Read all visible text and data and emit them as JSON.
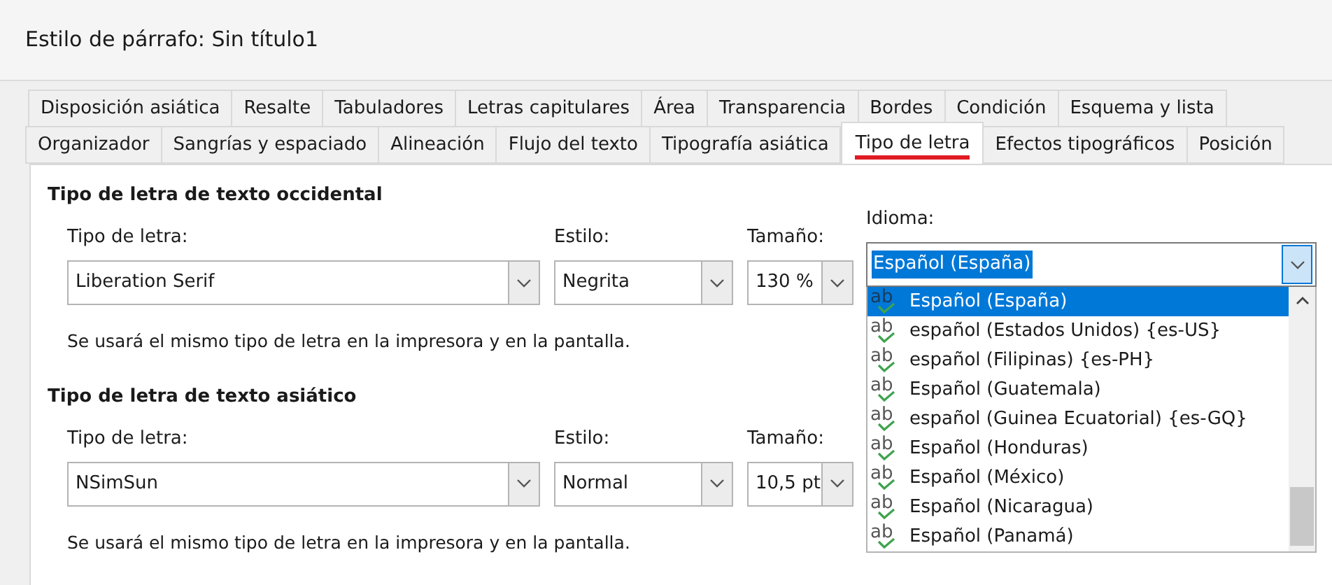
{
  "window": {
    "title": "Estilo de párrafo: Sin título1"
  },
  "tab_rows": [
    [
      {
        "label": "Disposición asiática",
        "selected": false
      },
      {
        "label": "Resalte",
        "selected": false
      },
      {
        "label": "Tabuladores",
        "selected": false
      },
      {
        "label": "Letras capitulares",
        "selected": false
      },
      {
        "label": "Área",
        "selected": false
      },
      {
        "label": "Transparencia",
        "selected": false
      },
      {
        "label": "Bordes",
        "selected": false
      },
      {
        "label": "Condición",
        "selected": false
      },
      {
        "label": "Esquema y lista",
        "selected": false
      }
    ],
    [
      {
        "label": "Organizador",
        "selected": false
      },
      {
        "label": "Sangrías y espaciado",
        "selected": false
      },
      {
        "label": "Alineación",
        "selected": false
      },
      {
        "label": "Flujo del texto",
        "selected": false
      },
      {
        "label": "Tipografía asiática",
        "selected": false
      },
      {
        "label": "Tipo de letra",
        "selected": true
      },
      {
        "label": "Efectos tipográficos",
        "selected": false
      },
      {
        "label": "Posición",
        "selected": false
      }
    ]
  ],
  "sections": [
    {
      "heading": "Tipo de letra de texto occidental",
      "font_label": "Tipo de letra:",
      "font": "Liberation Serif",
      "style_label": "Estilo:",
      "style": "Negrita",
      "size_label": "Tamaño:",
      "size": "130 %",
      "note": "Se usará el mismo tipo de letra en la impresora y en la pantalla."
    },
    {
      "heading": "Tipo de letra de texto asiático",
      "font_label": "Tipo de letra:",
      "font": "NSimSun",
      "style_label": "Estilo:",
      "style": "Normal",
      "size_label": "Tamaño:",
      "size": "10,5 pt",
      "note": "Se usará el mismo tipo de letra en la impresora y en la pantalla."
    }
  ],
  "language": {
    "label": "Idioma:",
    "value": "Español (España)",
    "expanded": true,
    "options": [
      {
        "icon_text": "ab",
        "label": "Español (España)",
        "selected": true
      },
      {
        "icon_text": "ab",
        "label": "español (Estados Unidos) {es-US}",
        "selected": false
      },
      {
        "icon_text": "ab",
        "label": "español (Filipinas) {es-PH}",
        "selected": false
      },
      {
        "icon_text": "ab",
        "label": "Español (Guatemala)",
        "selected": false
      },
      {
        "icon_text": "ab",
        "label": "español (Guinea Ecuatorial) {es-GQ}",
        "selected": false
      },
      {
        "icon_text": "ab",
        "label": "Español (Honduras)",
        "selected": false
      },
      {
        "icon_text": "ab",
        "label": "Español (México)",
        "selected": false
      },
      {
        "icon_text": "ab",
        "label": "Español (Nicaragua)",
        "selected": false
      },
      {
        "icon_text": "ab",
        "label": "Español (Panamá)",
        "selected": false
      }
    ]
  }
}
